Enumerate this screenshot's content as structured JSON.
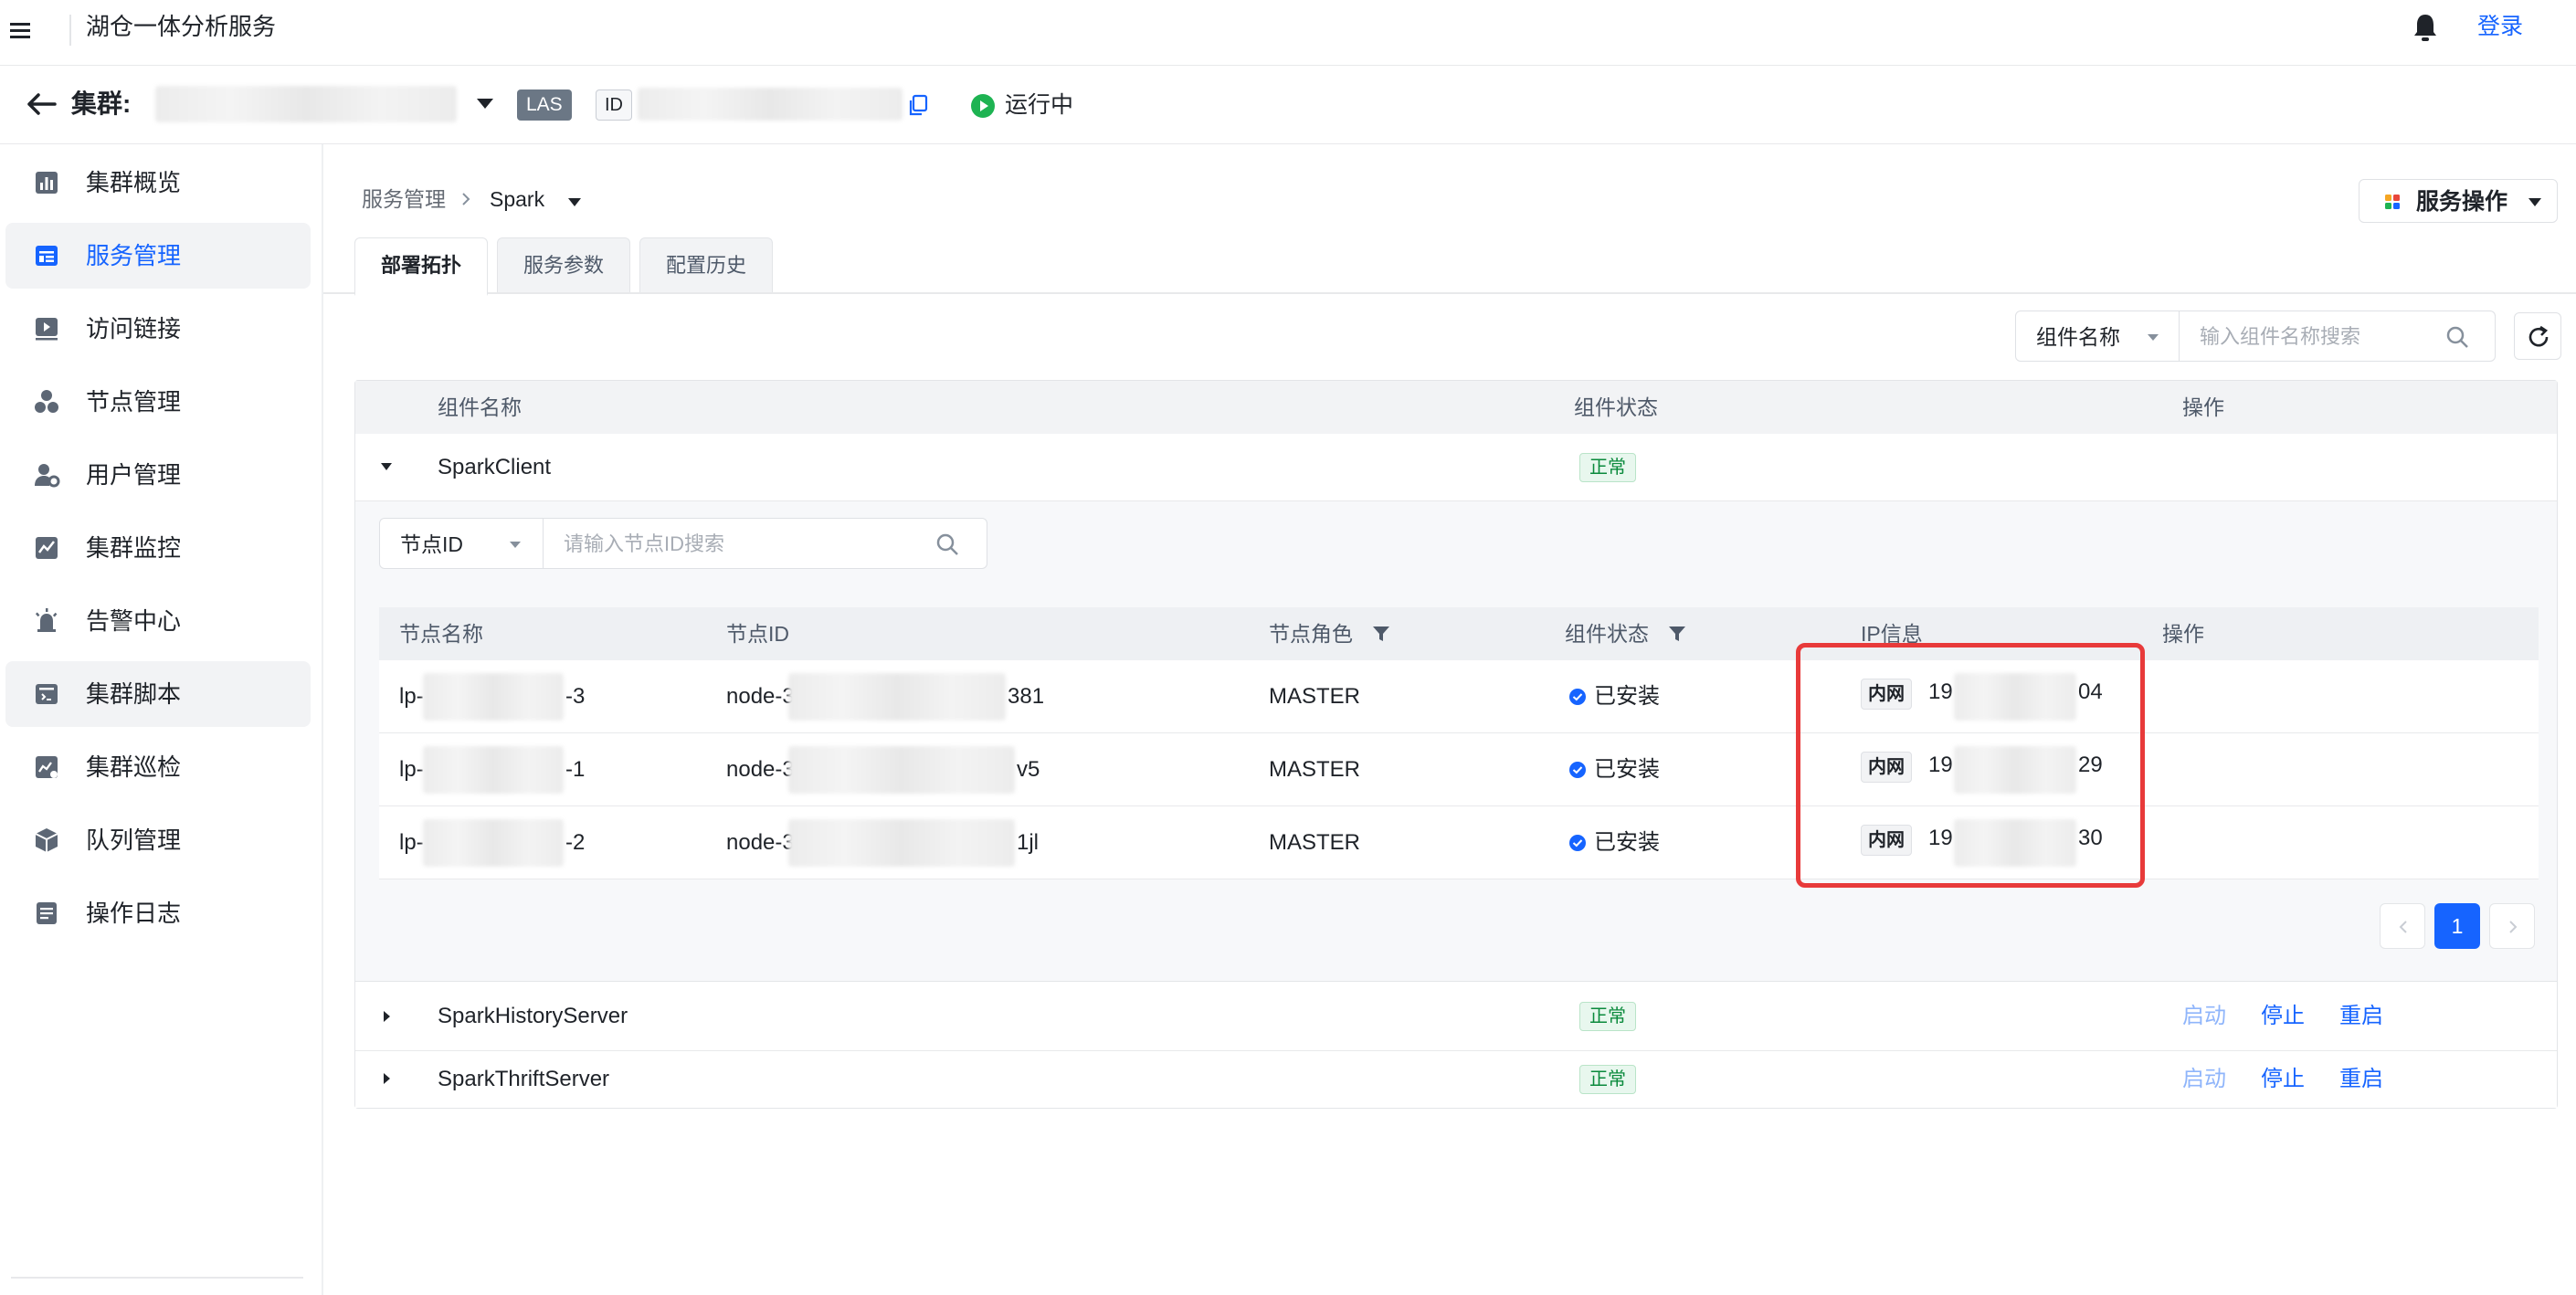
{
  "app": {
    "title": "湖仓一体分析服务",
    "login_label": "登录"
  },
  "cluster_bar": {
    "label": "集群:",
    "type_badge": "LAS",
    "id_badge": "ID",
    "status": "运行中",
    "status_color": "#1eb352"
  },
  "sidebar": {
    "items": [
      {
        "label": "集群概览",
        "icon": "chart-bar-icon"
      },
      {
        "label": "服务管理",
        "icon": "service-grid-icon",
        "active": true
      },
      {
        "label": "访问链接",
        "icon": "link-play-icon"
      },
      {
        "label": "节点管理",
        "icon": "nodes-icon"
      },
      {
        "label": "用户管理",
        "icon": "user-settings-icon"
      },
      {
        "label": "集群监控",
        "icon": "monitor-chart-icon"
      },
      {
        "label": "告警中心",
        "icon": "alarm-icon"
      },
      {
        "label": "集群脚本",
        "icon": "script-icon"
      },
      {
        "label": "集群巡检",
        "icon": "inspection-icon"
      },
      {
        "label": "队列管理",
        "icon": "queue-cube-icon"
      },
      {
        "label": "操作日志",
        "icon": "log-icon"
      }
    ],
    "active_color": "#1664ff"
  },
  "breadcrumb": {
    "parent": "服务管理",
    "current": "Spark"
  },
  "service_ops": {
    "label": "服务操作"
  },
  "tabs": [
    {
      "label": "部署拓扑",
      "active": true
    },
    {
      "label": "服务参数"
    },
    {
      "label": "配置历史"
    }
  ],
  "component_filter": {
    "select_value": "组件名称",
    "placeholder": "输入组件名称搜索"
  },
  "main_table": {
    "columns": [
      "组件名称",
      "组件状态",
      "操作"
    ],
    "rows": [
      {
        "name": "SparkClient",
        "status": "正常",
        "expanded": true
      },
      {
        "name": "SparkHistoryServer",
        "status": "正常",
        "actions": [
          "启动",
          "停止",
          "重启"
        ]
      },
      {
        "name": "SparkThriftServer",
        "status": "正常",
        "actions": [
          "启动",
          "停止",
          "重启"
        ]
      }
    ]
  },
  "node_filter": {
    "select_value": "节点ID",
    "placeholder": "请输入节点ID搜索"
  },
  "node_table": {
    "columns": [
      "节点名称",
      "节点ID",
      "节点角色",
      "组件状态",
      "IP信息",
      "操作"
    ],
    "rows": [
      {
        "name_prefix": "lp-",
        "name_suffix": "-3",
        "id_prefix": "node-3",
        "id_suffix": "381",
        "role": "MASTER",
        "status": "已安装",
        "net": "内网",
        "ip_prefix": "19",
        "ip_suffix": "04"
      },
      {
        "name_prefix": "lp-",
        "name_suffix": "-1",
        "id_prefix": "node-3",
        "id_suffix": "v5",
        "role": "MASTER",
        "status": "已安装",
        "net": "内网",
        "ip_prefix": "19",
        "ip_suffix": "29"
      },
      {
        "name_prefix": "lp-",
        "name_suffix": "-2",
        "id_prefix": "node-3",
        "id_suffix": "1jl",
        "role": "MASTER",
        "status": "已安装",
        "net": "内网",
        "ip_prefix": "19",
        "ip_suffix": "30"
      }
    ]
  },
  "pagination": {
    "current": "1"
  }
}
